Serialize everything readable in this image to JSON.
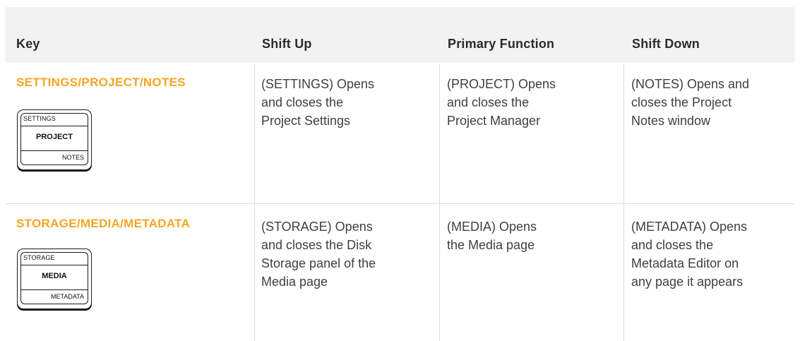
{
  "table": {
    "headers": {
      "key": "Key",
      "shift_up": "Shift Up",
      "primary": "Primary Function",
      "shift_down": "Shift Down"
    },
    "rows": [
      {
        "key_label": "SETTINGS/PROJECT/NOTES",
        "keycap": {
          "top": "SETTINGS",
          "middle": "PROJECT",
          "bottom": "NOTES"
        },
        "shift_up": [
          "(SETTINGS) Opens",
          "and closes the",
          "Project Settings"
        ],
        "primary": [
          "(PROJECT) Opens",
          "and closes the",
          "Project Manager"
        ],
        "shift_down": [
          "(NOTES) Opens and",
          "closes the Project",
          "Notes window"
        ]
      },
      {
        "key_label": "STORAGE/MEDIA/METADATA",
        "keycap": {
          "top": "STORAGE",
          "middle": "MEDIA",
          "bottom": "METADATA"
        },
        "shift_up": [
          "(STORAGE) Opens",
          "and closes the Disk",
          "Storage panel of the",
          "Media page"
        ],
        "primary": [
          "(MEDIA) Opens",
          "the Media page"
        ],
        "shift_down": [
          "(METADATA) Opens",
          "and closes the",
          "Metadata Editor on",
          "any page it appears"
        ]
      }
    ]
  },
  "colors": {
    "key_label": "#f5a623",
    "header_bg": "#f2f2f2",
    "grid_line": "#dcdcdc"
  }
}
